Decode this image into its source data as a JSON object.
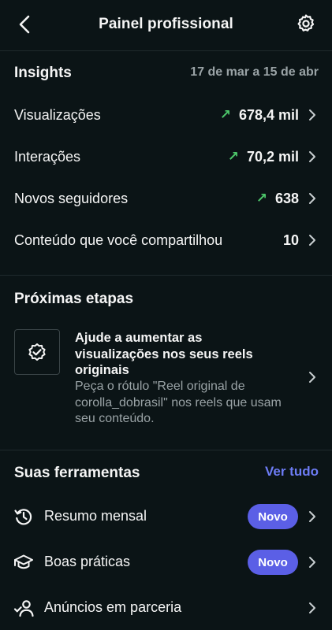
{
  "header": {
    "title": "Painel profissional"
  },
  "insights": {
    "title": "Insights",
    "date_range": "17 de mar a 15 de abr",
    "rows": [
      {
        "label": "Visualizações",
        "trend": "↗",
        "value": "678,4 mil"
      },
      {
        "label": "Interações",
        "trend": "↗",
        "value": "70,2 mil"
      },
      {
        "label": "Novos seguidores",
        "trend": "↗",
        "value": "638"
      },
      {
        "label": "Conteúdo que você compartilhou",
        "trend": "",
        "value": "10"
      }
    ]
  },
  "next_steps": {
    "title": "Próximas etapas",
    "card_title": "Ajude a aumentar as visualizações nos seus reels originais",
    "card_desc": "Peça o rótulo \"Reel original de corolla_dobrasil\" nos reels que usam seu conteúdo."
  },
  "tools": {
    "title": "Suas ferramentas",
    "see_all": "Ver tudo",
    "items": [
      {
        "label": "Resumo mensal",
        "badge": "Novo",
        "icon": "history-icon"
      },
      {
        "label": "Boas práticas",
        "badge": "Novo",
        "icon": "graduation-cap-icon"
      },
      {
        "label": "Anúncios em parceria",
        "badge": "",
        "icon": "partnership-icon"
      }
    ]
  },
  "colors": {
    "background": "#0b1416",
    "accent": "#5b5fe6",
    "link": "#6d7cf5",
    "trend_up": "#4cc66a",
    "muted": "#9aa3a6"
  }
}
